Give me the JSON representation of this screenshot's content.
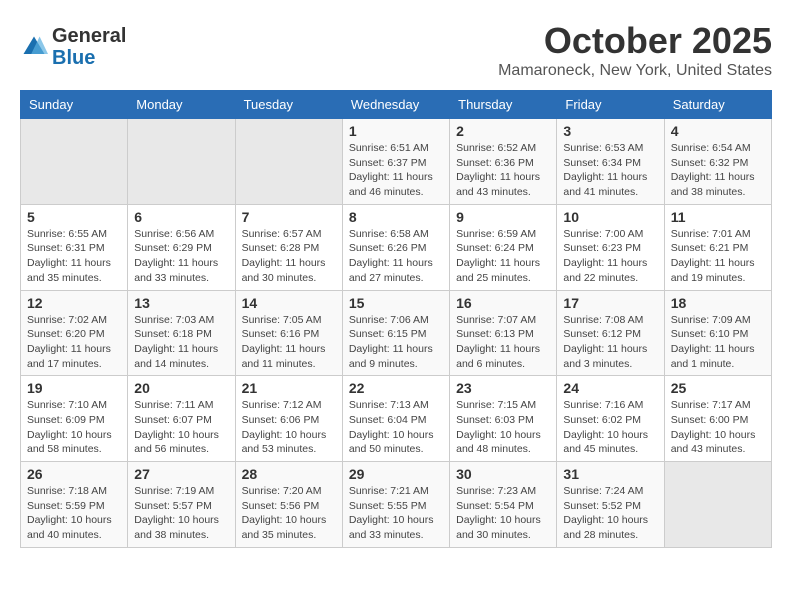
{
  "header": {
    "logo_general": "General",
    "logo_blue": "Blue",
    "month_title": "October 2025",
    "location": "Mamaroneck, New York, United States"
  },
  "weekdays": [
    "Sunday",
    "Monday",
    "Tuesday",
    "Wednesday",
    "Thursday",
    "Friday",
    "Saturday"
  ],
  "weeks": [
    [
      {
        "day": "",
        "info": ""
      },
      {
        "day": "",
        "info": ""
      },
      {
        "day": "",
        "info": ""
      },
      {
        "day": "1",
        "info": "Sunrise: 6:51 AM\nSunset: 6:37 PM\nDaylight: 11 hours\nand 46 minutes."
      },
      {
        "day": "2",
        "info": "Sunrise: 6:52 AM\nSunset: 6:36 PM\nDaylight: 11 hours\nand 43 minutes."
      },
      {
        "day": "3",
        "info": "Sunrise: 6:53 AM\nSunset: 6:34 PM\nDaylight: 11 hours\nand 41 minutes."
      },
      {
        "day": "4",
        "info": "Sunrise: 6:54 AM\nSunset: 6:32 PM\nDaylight: 11 hours\nand 38 minutes."
      }
    ],
    [
      {
        "day": "5",
        "info": "Sunrise: 6:55 AM\nSunset: 6:31 PM\nDaylight: 11 hours\nand 35 minutes."
      },
      {
        "day": "6",
        "info": "Sunrise: 6:56 AM\nSunset: 6:29 PM\nDaylight: 11 hours\nand 33 minutes."
      },
      {
        "day": "7",
        "info": "Sunrise: 6:57 AM\nSunset: 6:28 PM\nDaylight: 11 hours\nand 30 minutes."
      },
      {
        "day": "8",
        "info": "Sunrise: 6:58 AM\nSunset: 6:26 PM\nDaylight: 11 hours\nand 27 minutes."
      },
      {
        "day": "9",
        "info": "Sunrise: 6:59 AM\nSunset: 6:24 PM\nDaylight: 11 hours\nand 25 minutes."
      },
      {
        "day": "10",
        "info": "Sunrise: 7:00 AM\nSunset: 6:23 PM\nDaylight: 11 hours\nand 22 minutes."
      },
      {
        "day": "11",
        "info": "Sunrise: 7:01 AM\nSunset: 6:21 PM\nDaylight: 11 hours\nand 19 minutes."
      }
    ],
    [
      {
        "day": "12",
        "info": "Sunrise: 7:02 AM\nSunset: 6:20 PM\nDaylight: 11 hours\nand 17 minutes."
      },
      {
        "day": "13",
        "info": "Sunrise: 7:03 AM\nSunset: 6:18 PM\nDaylight: 11 hours\nand 14 minutes."
      },
      {
        "day": "14",
        "info": "Sunrise: 7:05 AM\nSunset: 6:16 PM\nDaylight: 11 hours\nand 11 minutes."
      },
      {
        "day": "15",
        "info": "Sunrise: 7:06 AM\nSunset: 6:15 PM\nDaylight: 11 hours\nand 9 minutes."
      },
      {
        "day": "16",
        "info": "Sunrise: 7:07 AM\nSunset: 6:13 PM\nDaylight: 11 hours\nand 6 minutes."
      },
      {
        "day": "17",
        "info": "Sunrise: 7:08 AM\nSunset: 6:12 PM\nDaylight: 11 hours\nand 3 minutes."
      },
      {
        "day": "18",
        "info": "Sunrise: 7:09 AM\nSunset: 6:10 PM\nDaylight: 11 hours\nand 1 minute."
      }
    ],
    [
      {
        "day": "19",
        "info": "Sunrise: 7:10 AM\nSunset: 6:09 PM\nDaylight: 10 hours\nand 58 minutes."
      },
      {
        "day": "20",
        "info": "Sunrise: 7:11 AM\nSunset: 6:07 PM\nDaylight: 10 hours\nand 56 minutes."
      },
      {
        "day": "21",
        "info": "Sunrise: 7:12 AM\nSunset: 6:06 PM\nDaylight: 10 hours\nand 53 minutes."
      },
      {
        "day": "22",
        "info": "Sunrise: 7:13 AM\nSunset: 6:04 PM\nDaylight: 10 hours\nand 50 minutes."
      },
      {
        "day": "23",
        "info": "Sunrise: 7:15 AM\nSunset: 6:03 PM\nDaylight: 10 hours\nand 48 minutes."
      },
      {
        "day": "24",
        "info": "Sunrise: 7:16 AM\nSunset: 6:02 PM\nDaylight: 10 hours\nand 45 minutes."
      },
      {
        "day": "25",
        "info": "Sunrise: 7:17 AM\nSunset: 6:00 PM\nDaylight: 10 hours\nand 43 minutes."
      }
    ],
    [
      {
        "day": "26",
        "info": "Sunrise: 7:18 AM\nSunset: 5:59 PM\nDaylight: 10 hours\nand 40 minutes."
      },
      {
        "day": "27",
        "info": "Sunrise: 7:19 AM\nSunset: 5:57 PM\nDaylight: 10 hours\nand 38 minutes."
      },
      {
        "day": "28",
        "info": "Sunrise: 7:20 AM\nSunset: 5:56 PM\nDaylight: 10 hours\nand 35 minutes."
      },
      {
        "day": "29",
        "info": "Sunrise: 7:21 AM\nSunset: 5:55 PM\nDaylight: 10 hours\nand 33 minutes."
      },
      {
        "day": "30",
        "info": "Sunrise: 7:23 AM\nSunset: 5:54 PM\nDaylight: 10 hours\nand 30 minutes."
      },
      {
        "day": "31",
        "info": "Sunrise: 7:24 AM\nSunset: 5:52 PM\nDaylight: 10 hours\nand 28 minutes."
      },
      {
        "day": "",
        "info": ""
      }
    ]
  ]
}
